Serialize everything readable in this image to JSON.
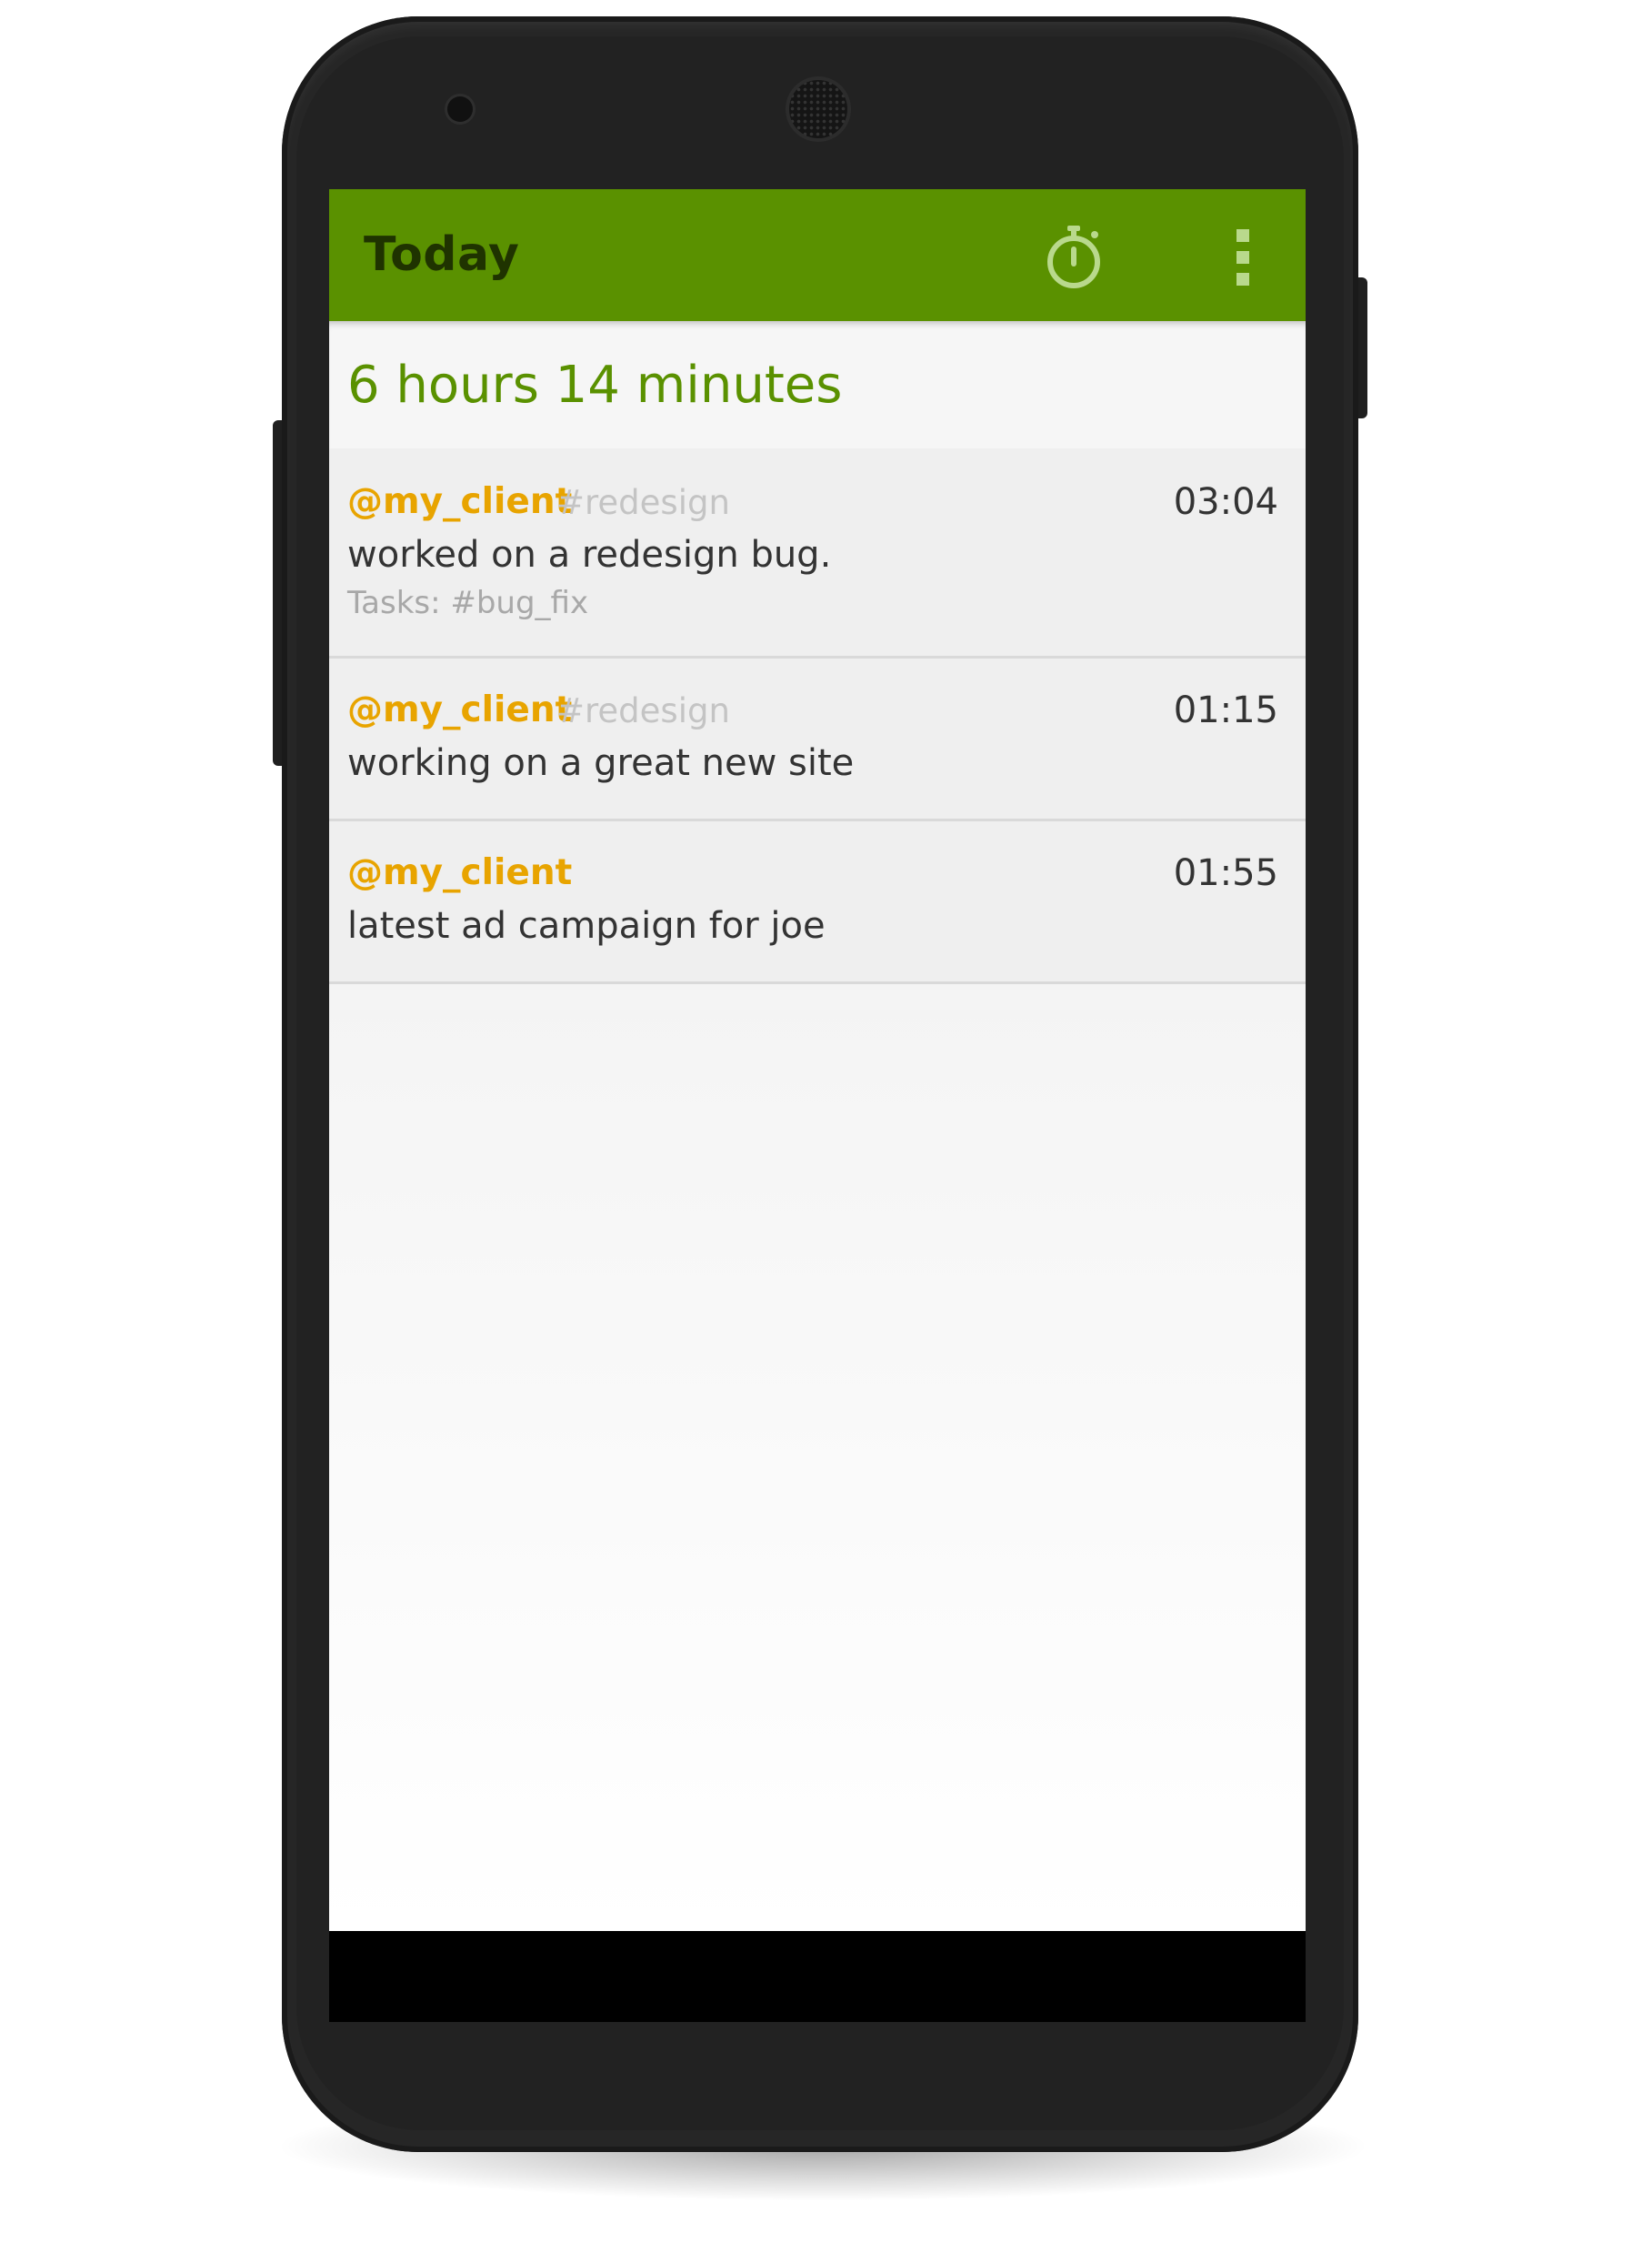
{
  "appbar": {
    "title": "Today",
    "timer_icon": "stopwatch-icon",
    "overflow_icon": "overflow-menu-icon",
    "color": "#5a9100"
  },
  "summary": {
    "total": "6 hours 14 minutes"
  },
  "entries": [
    {
      "client": "@my_client",
      "project": "#redesign",
      "duration": "03:04",
      "description": "worked on a redesign bug.",
      "tasks": "Tasks: #bug_fix"
    },
    {
      "client": "@my_client",
      "project": "#redesign",
      "duration": "01:15",
      "description": "working on a great new site"
    },
    {
      "client": "@my_client",
      "duration": "01:55",
      "description": "latest ad campaign for joe"
    }
  ],
  "colors": {
    "client": "#e8a400",
    "summary": "#5a9100"
  }
}
